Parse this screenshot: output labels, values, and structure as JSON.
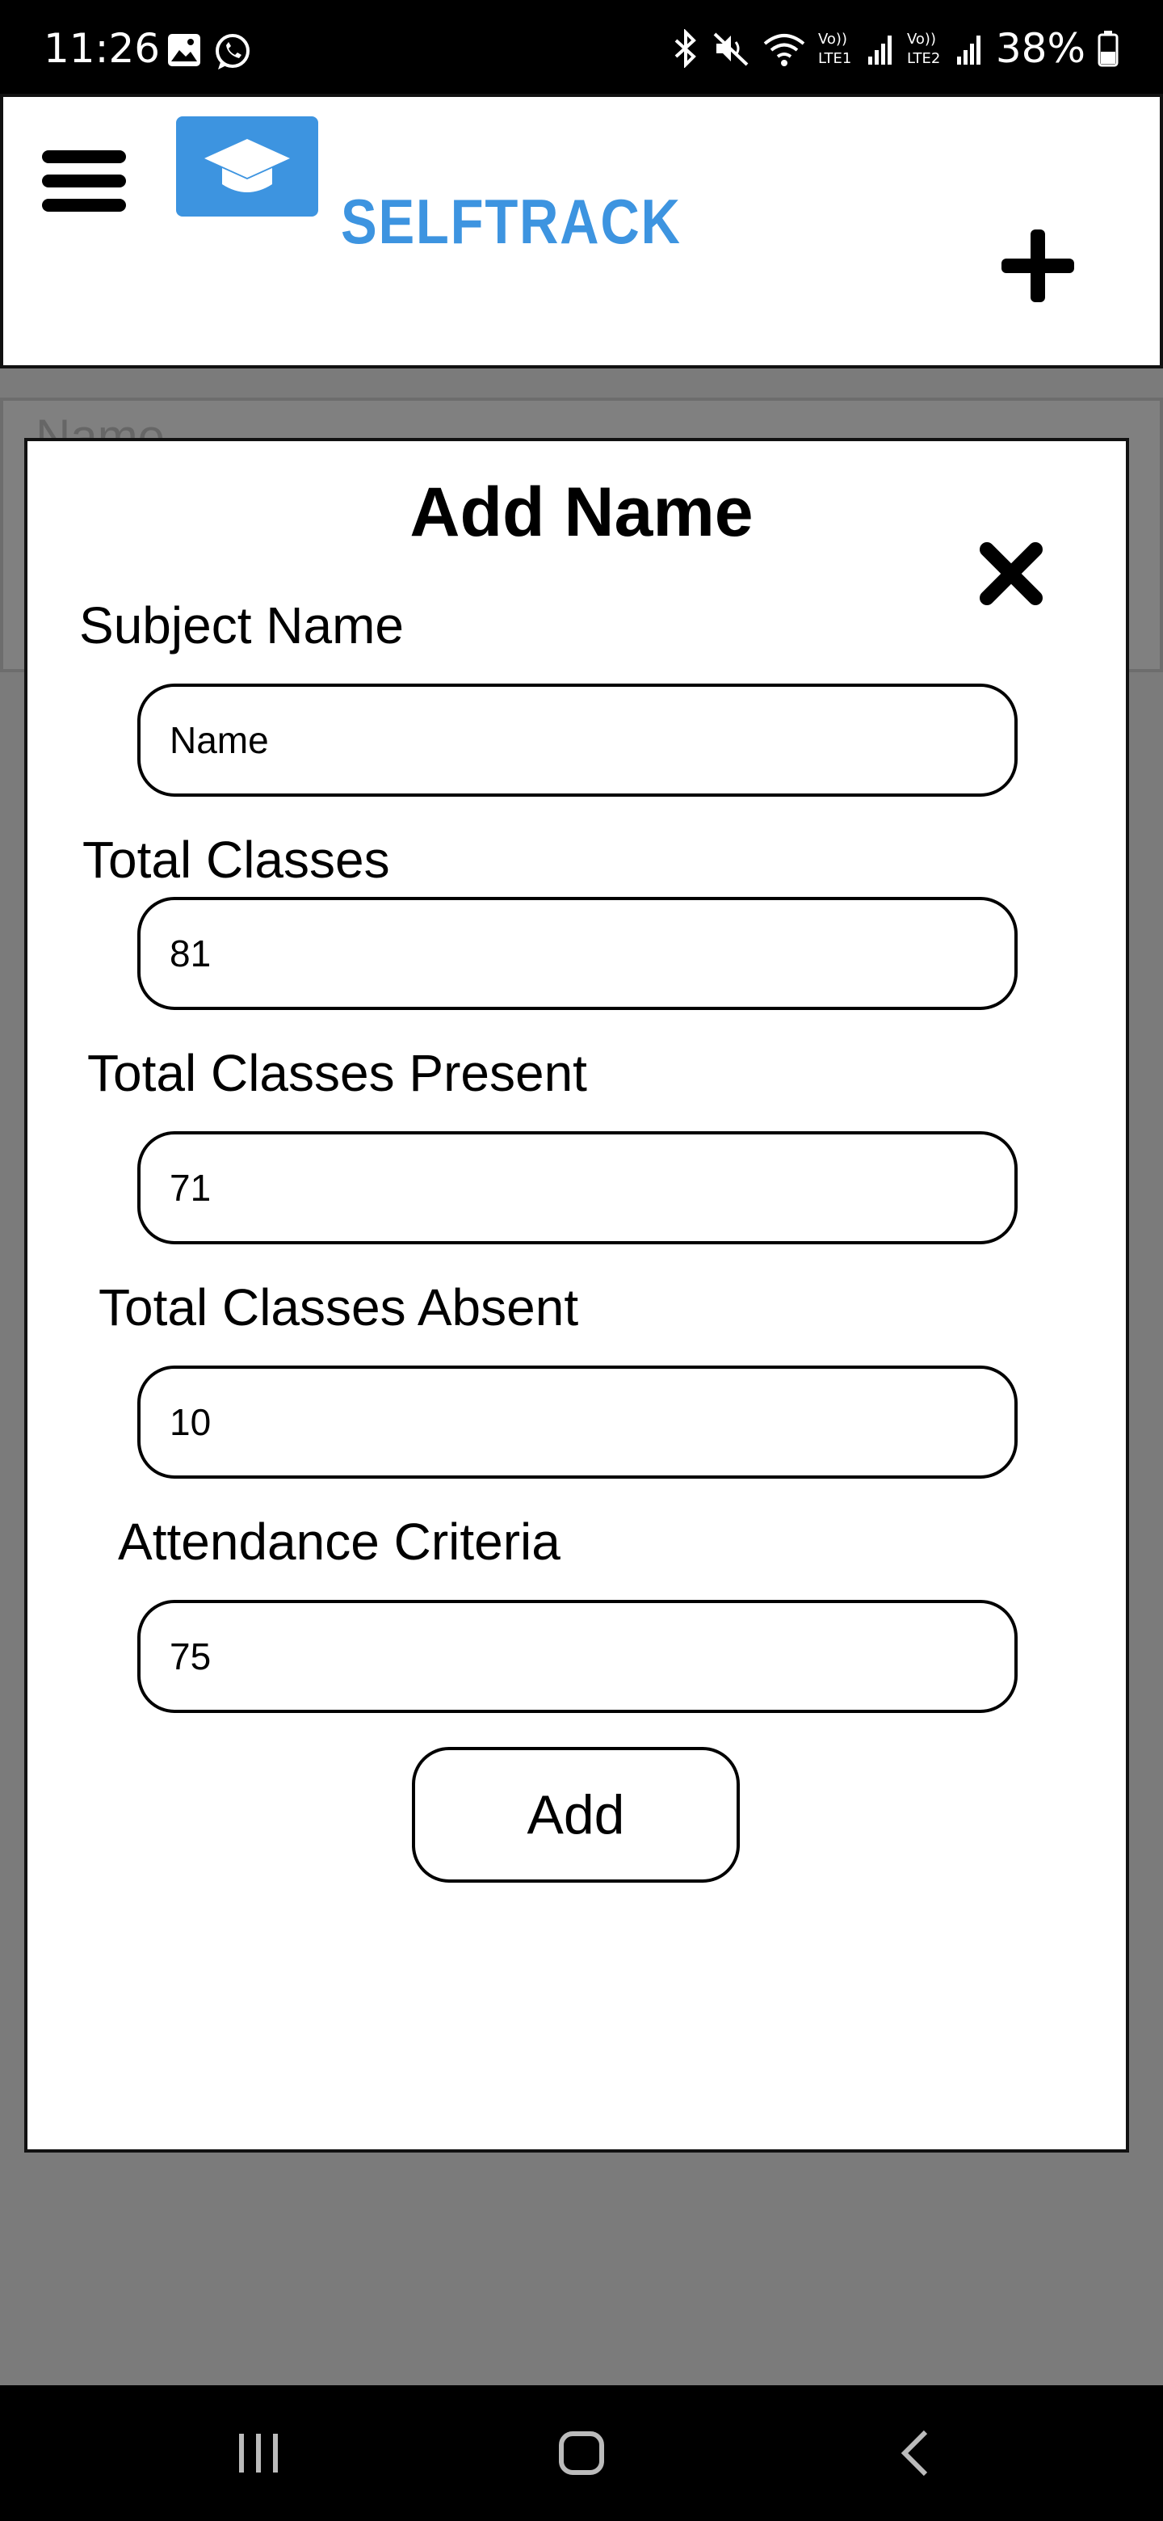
{
  "status_bar": {
    "time": "11:26",
    "battery": "38%",
    "left_icons": [
      "gallery-icon",
      "whatsapp-icon"
    ],
    "right_icons": [
      "bluetooth-icon",
      "mute-icon",
      "wifi-icon",
      "volte1-signal-icon",
      "volte2-signal-icon",
      "battery-icon"
    ]
  },
  "header": {
    "logo_text": "SELFTRACK",
    "menu_icon": "hamburger-menu-icon",
    "add_icon": "plus-icon",
    "accent_color": "#3d94e0"
  },
  "background_card": {
    "title": "Name"
  },
  "modal": {
    "title": "Add Name",
    "close_icon": "close-icon",
    "fields": [
      {
        "label": "Subject Name",
        "value": "Name"
      },
      {
        "label": "Total Classes",
        "value": "81"
      },
      {
        "label": "Total Classes Present",
        "value": "71"
      },
      {
        "label": "Total Classes Absent",
        "value": "10"
      },
      {
        "label": "Attendance Criteria",
        "value": "75"
      }
    ],
    "submit_label": "Add"
  },
  "nav_bar": {
    "icons": [
      "recents-icon",
      "home-icon",
      "back-icon"
    ]
  }
}
